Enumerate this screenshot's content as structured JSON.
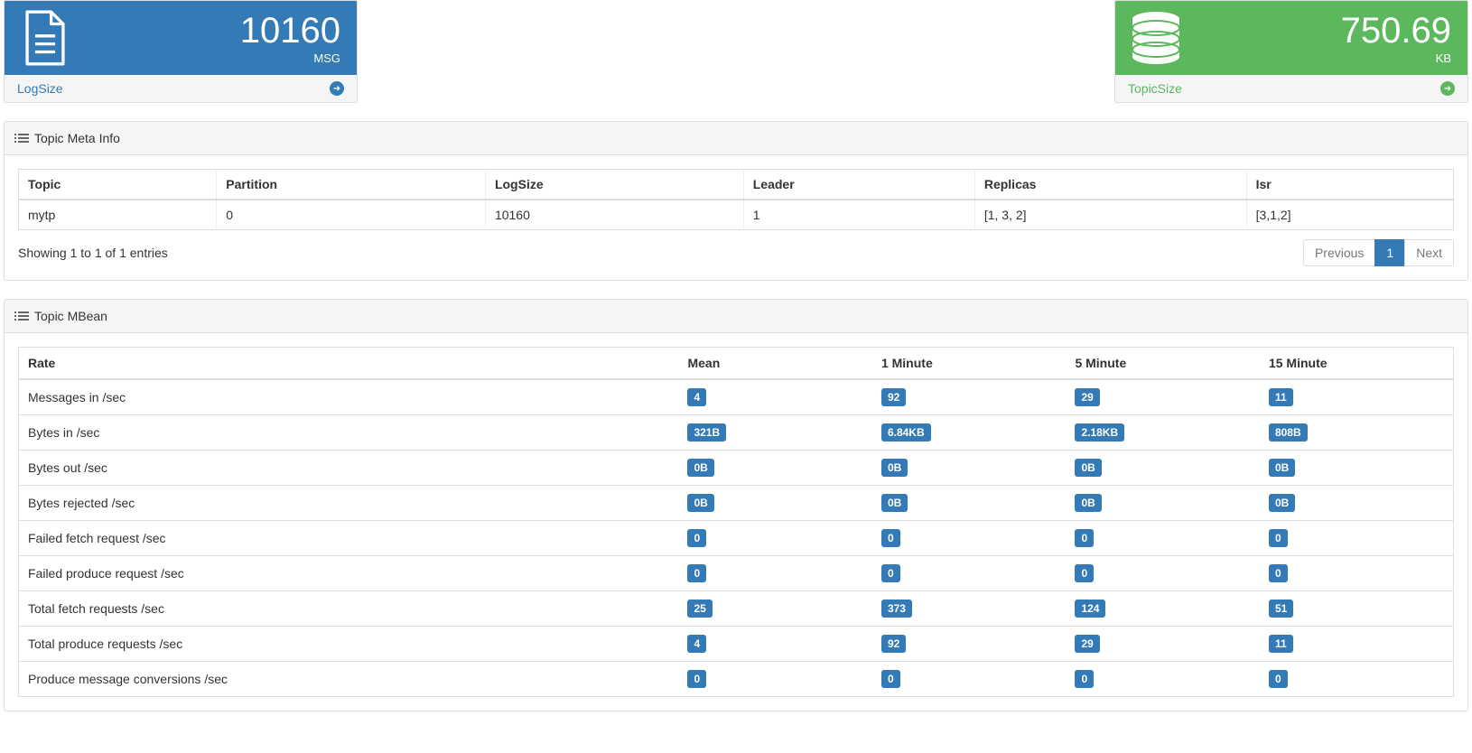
{
  "cards": {
    "logsize": {
      "value": "10160",
      "unit": "MSG",
      "label": "LogSize"
    },
    "topicsize": {
      "value": "750.69",
      "unit": "KB",
      "label": "TopicSize"
    }
  },
  "panels": {
    "meta": {
      "title": "Topic Meta Info"
    },
    "mbean": {
      "title": "Topic MBean"
    }
  },
  "meta_table": {
    "headers": [
      "Topic",
      "Partition",
      "LogSize",
      "Leader",
      "Replicas",
      "Isr"
    ],
    "rows": [
      [
        "mytp",
        "0",
        "10160",
        "1",
        "[1, 3, 2]",
        "[3,1,2]"
      ]
    ],
    "showing": "Showing 1 to 1 of 1 entries",
    "pagination": {
      "prev": "Previous",
      "page": "1",
      "next": "Next"
    }
  },
  "mbean_table": {
    "headers": [
      "Rate",
      "Mean",
      "1 Minute",
      "5 Minute",
      "15 Minute"
    ],
    "rows": [
      {
        "rate": "Messages in /sec",
        "mean": "4",
        "m1": "92",
        "m5": "29",
        "m15": "11"
      },
      {
        "rate": "Bytes in /sec",
        "mean": "321B",
        "m1": "6.84KB",
        "m5": "2.18KB",
        "m15": "808B"
      },
      {
        "rate": "Bytes out /sec",
        "mean": "0B",
        "m1": "0B",
        "m5": "0B",
        "m15": "0B"
      },
      {
        "rate": "Bytes rejected /sec",
        "mean": "0B",
        "m1": "0B",
        "m5": "0B",
        "m15": "0B"
      },
      {
        "rate": "Failed fetch request /sec",
        "mean": "0",
        "m1": "0",
        "m5": "0",
        "m15": "0"
      },
      {
        "rate": "Failed produce request /sec",
        "mean": "0",
        "m1": "0",
        "m5": "0",
        "m15": "0"
      },
      {
        "rate": "Total fetch requests /sec",
        "mean": "25",
        "m1": "373",
        "m5": "124",
        "m15": "51"
      },
      {
        "rate": "Total produce requests /sec",
        "mean": "4",
        "m1": "92",
        "m5": "29",
        "m15": "11"
      },
      {
        "rate": "Produce message conversions /sec",
        "mean": "0",
        "m1": "0",
        "m5": "0",
        "m15": "0"
      }
    ]
  }
}
